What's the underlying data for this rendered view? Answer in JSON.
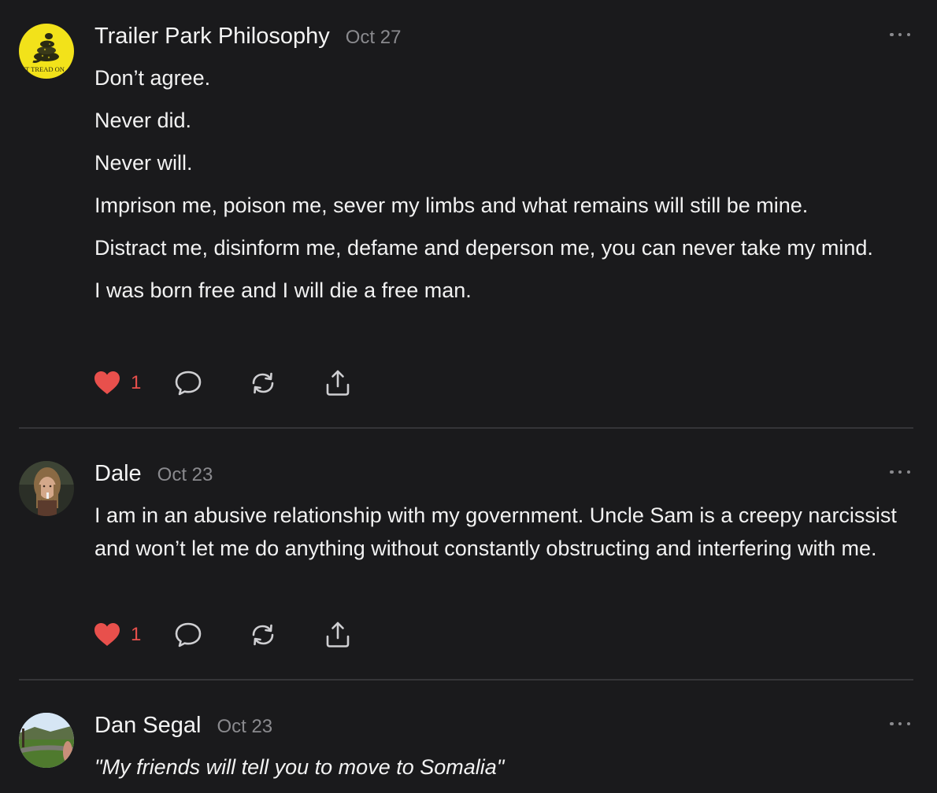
{
  "colors": {
    "background": "#1a1a1c",
    "text": "#f2f2f2",
    "muted": "#8a8a8e",
    "like": "#e8504c",
    "divider": "#353538"
  },
  "posts": [
    {
      "author": "Trailer Park Philosophy",
      "date": "Oct 27",
      "avatar": {
        "icon": "gadsden-flag-avatar",
        "caption": "NT TREAD ON"
      },
      "paragraphs": [
        "Don’t agree.",
        "Never did.",
        "Never will.",
        "Imprison me, poison me, sever my limbs and what remains will still be mine.",
        "Distract me, disinform me, defame and deperson me, you can never take my mind.",
        "I was born free and I will die a free man."
      ],
      "likes": "1"
    },
    {
      "author": "Dale",
      "date": "Oct 23",
      "avatar": {
        "icon": "person-photo-avatar"
      },
      "paragraphs": [
        "I am in an abusive relationship with my government. Uncle Sam is a creepy narcissist and won’t let me do anything without constantly obstructing and interfering with me."
      ],
      "likes": "1"
    },
    {
      "author": "Dan Segal",
      "date": "Oct 23",
      "avatar": {
        "icon": "landscape-photo-avatar"
      },
      "paragraphs": [
        "\"My friends will tell you to move to Somalia\""
      ]
    }
  ],
  "icons": {
    "like": "heart-icon",
    "comment": "comment-bubble-icon",
    "restack": "restack-arrows-icon",
    "share": "share-upload-icon",
    "more": "more-dots-icon"
  }
}
